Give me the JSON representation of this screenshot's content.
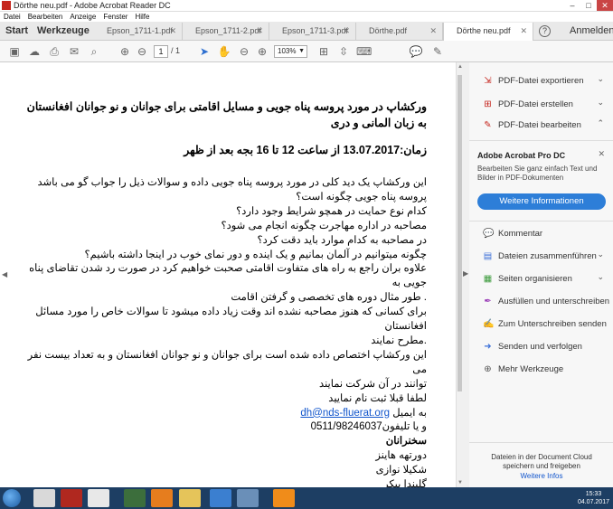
{
  "window": {
    "title": "Dörthe neu.pdf - Adobe Acrobat Reader DC"
  },
  "menu": [
    "Datei",
    "Bearbeiten",
    "Anzeige",
    "Fenster",
    "Hilfe"
  ],
  "tabs": {
    "start": "Start",
    "tools": "Werkzeuge",
    "documents": [
      "Epson_1711-1.pdf",
      "Epson_1711-2.pdf",
      "Epson_1711-3.pdf",
      "Dörthe.pdf",
      "Dörthe neu.pdf"
    ],
    "help": "?",
    "signin": "Anmelden"
  },
  "toolbar": {
    "page_current": "1",
    "page_total": "/ 1",
    "zoom": "103%"
  },
  "document": {
    "heading": "ورکشاپ در مورد پروسه پناه جویی و مسایل اقامتی برای جوانان و نو جوانان افغانستان به زبان المانی و دری",
    "time": "زمان:13.07.2017 از ساعت 12 تا 16 بجه بعد از ظهر",
    "lines": [
      "این ورکشاپ یک دید کلی در مورد پروسه پناه جویی داده و سوالات ذیل را جواب گو می باشد",
      "پروسه پناه جویی چگونه است؟",
      "کدام نوع حمایت در همچو شرایط وجود دارد؟",
      "مصاحبه در اداره مهاجرت چگونه انجام می شود؟",
      "در مصاحبه به کدام موارد باید دقت کرد؟",
      "چگونه میتوانیم در آلمان بمانیم و یک اینده و دور نمای خوب در اینجا داشته باشیم؟",
      "علاوه بران راجع به راه های متفاوت اقامتی صحبت خواهیم کرد در صورت رد شدن تقاضای پناه جویی به",
      ". طور مثال دوره های تخصصی و گرفتن اقامت",
      "برای کسانی که هنوز مصاحبه نشده اند وقت زیاد داده میشود تا سوالات خاص را مورد مسائل افغانستان",
      ".مطرح نمایند",
      "این ورکشاپ اختصاص داده شده است برای جوانان و نو جوانان افغانستان و به تعداد بیست نفر می",
      "توانند در آن شرکت نمایند",
      "لطفا قبلا ثبت نام نمایید"
    ],
    "email_prefix": "به ایمیل",
    "email": "dh@nds-fluerat.org",
    "phone": "و یا تلیفون0511/98246037",
    "speakers_heading": "سخنرانان",
    "speakers": [
      "دورتهه هاينز",
      "شکیلا نوازی",
      "گلیندا بیکر"
    ]
  },
  "sidebar": {
    "top_items": [
      {
        "label": "PDF-Datei exportieren",
        "icon": "export-pdf-icon",
        "chevron": "⌄"
      },
      {
        "label": "PDF-Datei erstellen",
        "icon": "create-pdf-icon",
        "chevron": "⌄"
      },
      {
        "label": "PDF-Datei bearbeiten",
        "icon": "edit-pdf-icon",
        "chevron": "⌃"
      }
    ],
    "promo": {
      "title": "Adobe Acrobat Pro DC",
      "text": "Bearbeiten Sie ganz einfach Text und Bilder in PDF-Dokumenten",
      "button": "Weitere Informationen"
    },
    "tools": [
      {
        "label": "Kommentar",
        "icon": "comment-icon"
      },
      {
        "label": "Dateien zusammenführen",
        "icon": "combine-files-icon",
        "chevron": "⌄"
      },
      {
        "label": "Seiten organisieren",
        "icon": "organize-pages-icon",
        "chevron": "⌄"
      },
      {
        "label": "Ausfüllen und unterschreiben",
        "icon": "fill-sign-icon"
      },
      {
        "label": "Zum Unterschreiben senden",
        "icon": "send-for-signature-icon"
      },
      {
        "label": "Senden und verfolgen",
        "icon": "send-track-icon"
      },
      {
        "label": "Mehr Werkzeuge",
        "icon": "more-tools-icon"
      }
    ],
    "cloud_text": "Dateien in der Document Cloud speichern und freigeben",
    "cloud_link": "Weitere Infos"
  },
  "taskbar": {
    "time": "15:33",
    "date": "04.07.2017"
  },
  "colors": {
    "accent": "#2d7ed8",
    "adobe_red": "#c6261e",
    "taskbar": "#1d3e63"
  }
}
